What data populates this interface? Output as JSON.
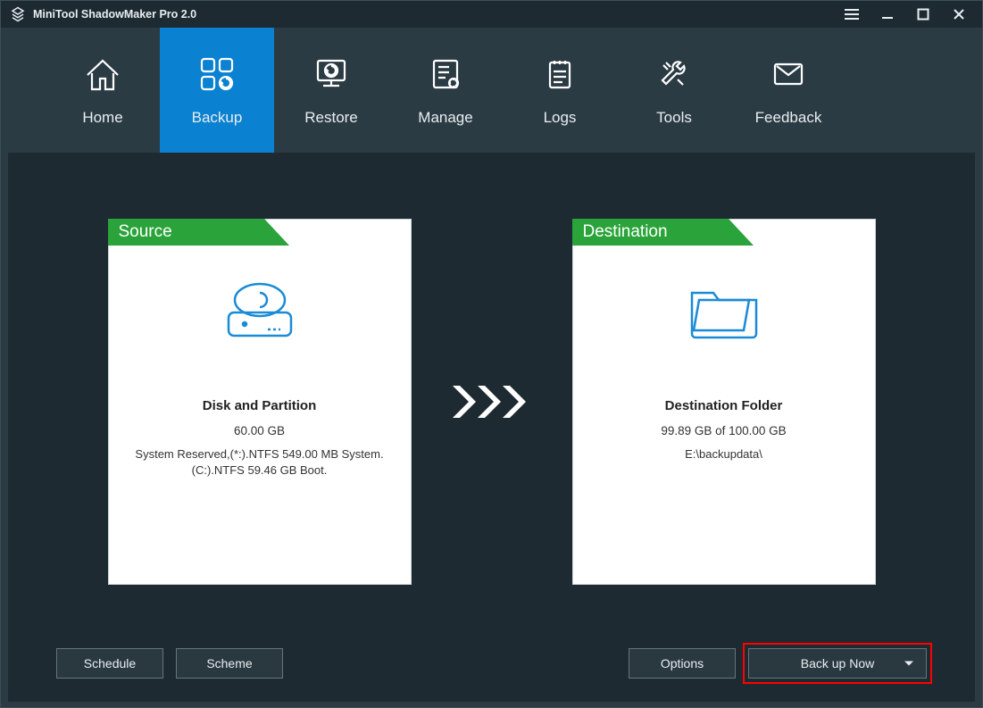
{
  "app": {
    "title": "MiniTool ShadowMaker Pro 2.0"
  },
  "nav": {
    "items": [
      {
        "label": "Home"
      },
      {
        "label": "Backup"
      },
      {
        "label": "Restore"
      },
      {
        "label": "Manage"
      },
      {
        "label": "Logs"
      },
      {
        "label": "Tools"
      },
      {
        "label": "Feedback"
      }
    ]
  },
  "source": {
    "ribbon": "Source",
    "title": "Disk and Partition",
    "size": "60.00 GB",
    "desc": "System Reserved,(*:).NTFS 549.00 MB System. (C:).NTFS 59.46 GB Boot."
  },
  "destination": {
    "ribbon": "Destination",
    "title": "Destination Folder",
    "size": "99.89 GB of 100.00 GB",
    "path": "E:\\backupdata\\"
  },
  "footer": {
    "schedule": "Schedule",
    "scheme": "Scheme",
    "options": "Options",
    "backup_now": "Back up Now"
  }
}
